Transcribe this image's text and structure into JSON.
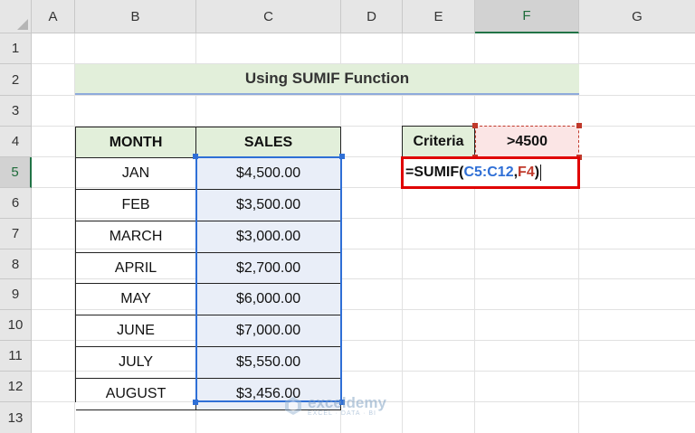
{
  "columns": [
    "A",
    "B",
    "C",
    "D",
    "E",
    "F",
    "G"
  ],
  "rows": [
    "1",
    "2",
    "3",
    "4",
    "5",
    "6",
    "7",
    "8",
    "9",
    "10",
    "11",
    "12",
    "13"
  ],
  "title": "Using SUMIF Function",
  "table": {
    "headers": [
      "MONTH",
      "SALES"
    ],
    "rows": [
      {
        "month": "JAN",
        "sales": "$4,500.00"
      },
      {
        "month": "FEB",
        "sales": "$3,500.00"
      },
      {
        "month": "MARCH",
        "sales": "$3,000.00"
      },
      {
        "month": "APRIL",
        "sales": "$2,700.00"
      },
      {
        "month": "MAY",
        "sales": "$6,000.00"
      },
      {
        "month": "JUNE",
        "sales": "$7,000.00"
      },
      {
        "month": "JULY",
        "sales": "$5,550.00"
      },
      {
        "month": "AUGUST",
        "sales": "$3,456.00"
      }
    ]
  },
  "criteria": {
    "label": "Criteria",
    "value": ">4500"
  },
  "formula": {
    "prefix": "=SUMIF(",
    "range": "C5:C12",
    "sep": ",",
    "ref": "F4",
    "suffix": ")"
  },
  "watermark": {
    "name": "exceldemy",
    "tagline": "EXCEL · DATA · BI"
  },
  "colors": {
    "range_ref": "#2f6fd6",
    "cell_ref": "#c0392b",
    "active_border": "#e00000",
    "header_fill": "#e2efda",
    "range_fill": "#e9eef8"
  }
}
